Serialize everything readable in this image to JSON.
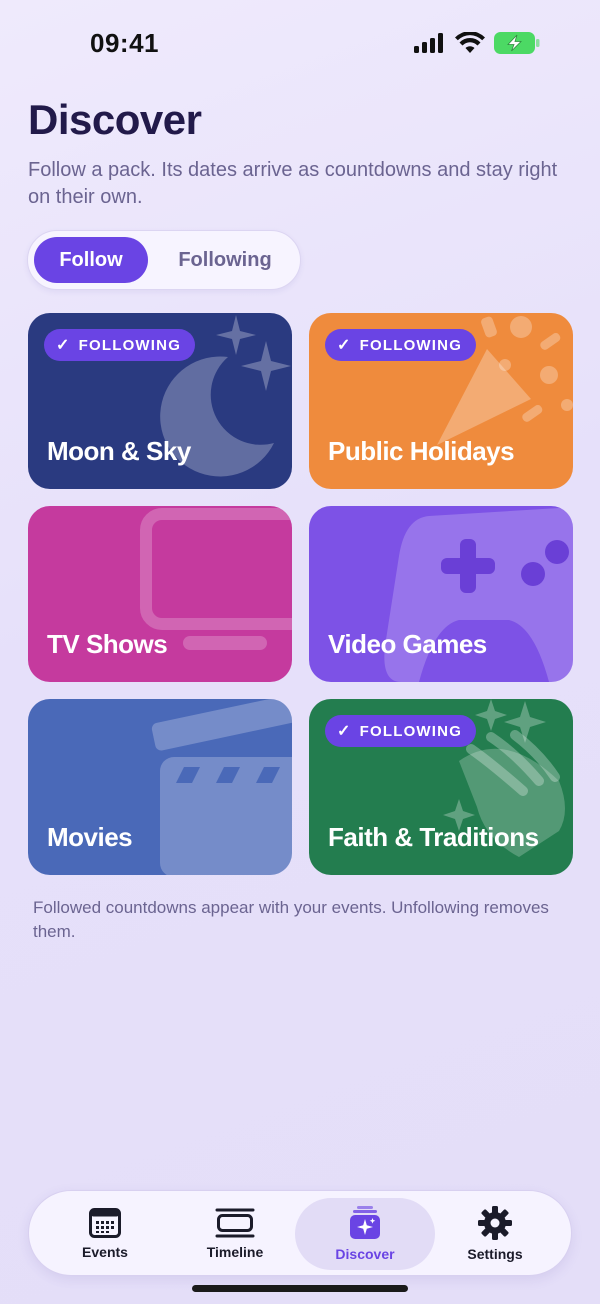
{
  "status": {
    "time": "09:41"
  },
  "header": {
    "title": "Discover",
    "subtitle": "Follow a pack. Its dates arrive as countdowns and stay right on their own."
  },
  "segmented": {
    "follow_label": "Follow",
    "following_label": "Following",
    "selected": "Follow"
  },
  "packs": [
    {
      "title": "Moon & Sky",
      "following": true,
      "badge": "FOLLOWING",
      "color": "#2a3a80",
      "icon": "moon-icon"
    },
    {
      "title": "Public Holidays",
      "following": true,
      "badge": "FOLLOWING",
      "color": "#ef8b3d",
      "icon": "party-popper-icon"
    },
    {
      "title": "TV Shows",
      "following": false,
      "color": "#c53a9e",
      "icon": "tv-icon"
    },
    {
      "title": "Video Games",
      "following": false,
      "color": "#7d52e6",
      "icon": "gamepad-icon"
    },
    {
      "title": "Movies",
      "following": false,
      "color": "#4a69b8",
      "icon": "clapperboard-icon"
    },
    {
      "title": "Faith & Traditions",
      "following": true,
      "badge": "FOLLOWING",
      "color": "#237d4f",
      "icon": "praying-hands-icon"
    }
  ],
  "footnote": "Followed countdowns appear with your events. Unfollowing removes them.",
  "tabs": [
    {
      "label": "Events",
      "icon": "calendar-icon"
    },
    {
      "label": "Timeline",
      "icon": "timeline-icon"
    },
    {
      "label": "Discover",
      "icon": "discover-icon",
      "active": true
    },
    {
      "label": "Settings",
      "icon": "gear-icon"
    }
  ],
  "colors": {
    "accent": "#6a44e4",
    "title": "#221a4a",
    "muted": "#6b6491"
  }
}
